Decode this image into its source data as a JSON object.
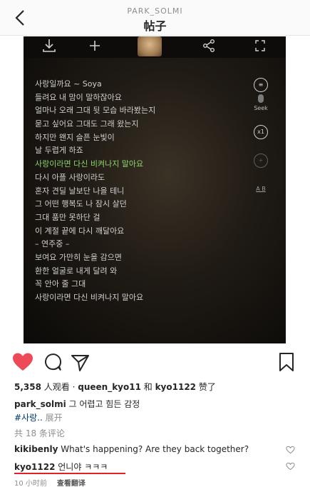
{
  "header": {
    "username": "PARK_SOLMI",
    "title": "帖子"
  },
  "lyrics_screen": {
    "lines": [
      "사랑일까요 ~ Soya",
      "들려요 내 맘이 말하잖아요",
      "얼마나 오래 그대 뒷 모습 바라봤는지",
      "묻고 싶어요 그대도 그래 왔는지",
      "하지만 왠지 슬픈 눈빛이",
      "날 두렵게 하죠",
      "사랑이라면 다신 비켜나지 말아요",
      "다시 아플 사랑이라도",
      "혼자 견딜 날보단 나을 테니",
      "그 어떤 행복도 나 잠시 살던",
      "그대 품만 못하단 걸",
      "이 계절 끝에 다시 깨달아요",
      "– 연주중 –",
      "보여요 가만히 눈을 감으면",
      "환한 얼굴로 내게 달려 와",
      "꼭 안아 줄 그대",
      "사랑이라면 다신 비켜나지 말아요"
    ],
    "highlight_index": 6,
    "side_controls": {
      "seek_label": "Seek",
      "speed_label": "x1",
      "ab_label": "A B"
    },
    "colors": {
      "lyric_text": "#cfcfcf",
      "lyric_highlight": "#8fd46e"
    }
  },
  "actions": {
    "icons": [
      "heart-icon",
      "comment-icon",
      "share-icon",
      "bookmark-icon"
    ],
    "liked": true,
    "like_color": "#ed4956"
  },
  "views": {
    "count": "5,358",
    "suffix": " 人观看 · ",
    "liker1": "queen_kyo11",
    "and": " 和 ",
    "liker2": "kyo1122",
    "liked": " 赞了"
  },
  "caption": {
    "user": "park_solmi",
    "text": " 그 어렵고 힘든 감정"
  },
  "tag": {
    "hashtag": "#사랑..",
    "more": " 展开"
  },
  "comments_count": "共 18 条评论",
  "comments": [
    {
      "user": "kikibenly",
      "text": " What's happening?  Are they back together?"
    },
    {
      "user": "kyo1122",
      "text": " 언니야 ㅋㅋㅋ"
    }
  ],
  "meta": {
    "time": "10 小时前",
    "reply": "查看翻译"
  },
  "underline_color": "#e0202e"
}
